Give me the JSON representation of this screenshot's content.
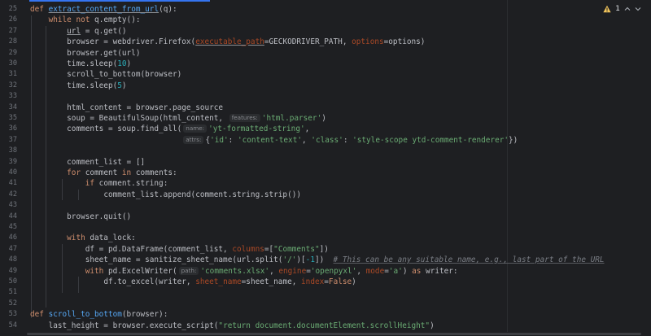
{
  "status": {
    "warning_count": "1"
  },
  "colors": {
    "accent": "#3574f0",
    "warning": "#f2c55c",
    "keyword": "#cf8e6d",
    "function": "#56a8f5",
    "string": "#6aab73",
    "number": "#2aacb8"
  },
  "line_numbers": [
    "25",
    "26",
    "27",
    "28",
    "29",
    "30",
    "31",
    "32",
    "33",
    "34",
    "35",
    "36",
    "37",
    "38",
    "39",
    "40",
    "41",
    "42",
    "43",
    "44",
    "45",
    "46",
    "47",
    "48",
    "49",
    "50",
    "51",
    "52",
    "53",
    "54"
  ],
  "code": {
    "l25": {
      "kw": "def",
      "fn": "extract_content_from_url",
      "rest": "(q):"
    },
    "l26": {
      "indent": "    ",
      "kw1": "while",
      "sp": " ",
      "kw2": "not",
      "rest": " q.empty():"
    },
    "l27": {
      "indent": "        ",
      "var": "url",
      "rest": " = q.get()"
    },
    "l28": {
      "indent": "        ",
      "pre": "browser = webdriver.Firefox(",
      "p1": "executable_path",
      "mid": "=GECKODRIVER_PATH, ",
      "p2": "options",
      "post": "=options)"
    },
    "l29": {
      "indent": "        ",
      "rest": "browser.get(url)"
    },
    "l30": {
      "indent": "        ",
      "pre": "time.sleep(",
      "num": "10",
      "post": ")"
    },
    "l31": {
      "indent": "        ",
      "rest": "scroll_to_bottom(browser)"
    },
    "l32": {
      "indent": "        ",
      "pre": "time.sleep(",
      "num": "5",
      "post": ")"
    },
    "l33": {
      "rest": ""
    },
    "l34": {
      "indent": "        ",
      "rest": "html_content = browser.page_source"
    },
    "l35": {
      "indent": "        ",
      "pre": "soup = BeautifulSoup(html_content, ",
      "hint": "features:",
      "str": "'html.parser'",
      "post": ")"
    },
    "l36": {
      "indent": "        ",
      "pre": "comments = soup.find_all(",
      "hint": "name:",
      "str": "'yt-formatted-string'",
      "post": ","
    },
    "l37": {
      "indent": "                                 ",
      "hint": "attrs:",
      "s0": "{",
      "s1": "'id'",
      "s2": ": ",
      "s3": "'content-text'",
      "s4": ", ",
      "s5": "'class'",
      "s6": ": ",
      "s7": "'style-scope ytd-comment-renderer'",
      "s8": "})"
    },
    "l38": {
      "rest": ""
    },
    "l39": {
      "indent": "        ",
      "rest": "comment_list = []"
    },
    "l40": {
      "indent": "        ",
      "kw1": "for",
      "mid": " comment ",
      "kw2": "in",
      "post": " comments:"
    },
    "l41": {
      "indent": "            ",
      "kw": "if",
      "rest": " comment.string:"
    },
    "l42": {
      "indent": "                ",
      "rest": "comment_list.append(comment.string.strip())"
    },
    "l43": {
      "rest": ""
    },
    "l44": {
      "indent": "        ",
      "rest": "browser.quit()"
    },
    "l45": {
      "rest": ""
    },
    "l46": {
      "indent": "        ",
      "kw": "with",
      "rest": " data_lock:"
    },
    "l47": {
      "indent": "            ",
      "pre": "df = pd.DataFrame(comment_list, ",
      "p1": "columns",
      "mid": "=[",
      "str": "\"Comments\"",
      "post": "])"
    },
    "l48": {
      "indent": "            ",
      "pre": "sheet_name = sanitize_sheet_name(url.split(",
      "str": "'/'",
      "mid": ")[",
      "num": "-1",
      "post": "])  ",
      "cmt": "# This can be any suitable name, e.g., last part of the URL"
    },
    "l49": {
      "indent": "            ",
      "kw1": "with",
      "pre": " pd.ExcelWriter(",
      "hint": "path:",
      "s1": "'comments.xlsx'",
      "c1": ", ",
      "p1": "engine",
      "e1": "=",
      "s2": "'openpyxl'",
      "c2": ", ",
      "p2": "mode",
      "e2": "=",
      "s3": "'a'",
      "c3": ") ",
      "kw2": "as",
      "post": " writer:"
    },
    "l50": {
      "indent": "                ",
      "pre": "df.to_excel(writer, ",
      "p1": "sheet_name",
      "mid": "=sheet_name, ",
      "p2": "index",
      "eq": "=",
      "kw": "False",
      "post": ")"
    },
    "l51": {
      "rest": ""
    },
    "l52": {
      "rest": ""
    },
    "l53": {
      "kw": "def",
      "fn": "scroll_to_bottom",
      "rest": "(browser):"
    },
    "l54": {
      "indent": "    ",
      "pre": "last_height = browser.execute_script(",
      "str": "\"return document.documentElement.scrollHeight\"",
      "post": ")"
    }
  }
}
